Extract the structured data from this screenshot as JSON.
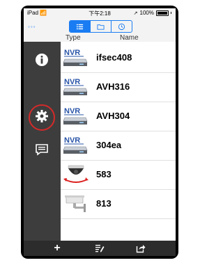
{
  "status_bar": {
    "device": "iPad",
    "time": "下午2:18",
    "battery": "100%"
  },
  "header": {
    "menu_dots": "◦◦◦",
    "segments": [
      "list-icon",
      "folder-icon",
      "clock-icon"
    ],
    "active_segment": 0
  },
  "columns": {
    "type": "Type",
    "name": "Name"
  },
  "sidebar": {
    "items": [
      {
        "name": "info",
        "icon": "info-icon"
      },
      {
        "name": "settings",
        "icon": "gear-icon",
        "highlighted": true
      },
      {
        "name": "messages",
        "icon": "message-icon"
      }
    ]
  },
  "devices": [
    {
      "type_label": "NVR",
      "kind": "nvr",
      "name": "ifsec408"
    },
    {
      "type_label": "NVR",
      "kind": "nvr",
      "name": "AVH316"
    },
    {
      "type_label": "NVR",
      "kind": "nvr",
      "name": "AVH304"
    },
    {
      "type_label": "NVR",
      "kind": "nvr",
      "name": "304ea"
    },
    {
      "type_label": "",
      "kind": "dome-camera",
      "name": "583"
    },
    {
      "type_label": "",
      "kind": "bullet-camera",
      "name": "813"
    }
  ],
  "toolbar": {
    "add": "+",
    "icons": [
      "plus-icon",
      "edit-list-icon",
      "share-icon"
    ]
  },
  "colors": {
    "accent": "#1a7cf2",
    "sidebar": "#3d3d3d",
    "highlight_ring": "#d42a2a"
  }
}
